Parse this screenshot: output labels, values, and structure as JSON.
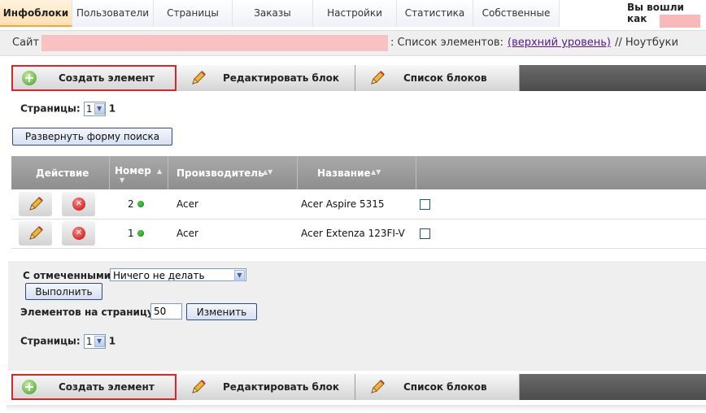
{
  "tabs": [
    {
      "label": "Инфоблоки",
      "active": true
    },
    {
      "label": "Пользователи"
    },
    {
      "label": "Страницы"
    },
    {
      "label": "Заказы"
    },
    {
      "label": "Настройки"
    },
    {
      "label": "Статистика"
    },
    {
      "label": "Собственные"
    }
  ],
  "header": {
    "login_text": "Вы вошли как"
  },
  "breadcrumb": {
    "site_label": "Сайт",
    "list_label": ": Список элементов:",
    "top_level_link": "(верхний уровень)",
    "tail": "// Ноутбуки"
  },
  "toolbar": {
    "create_label": "Создать элемент",
    "edit_block_label": "Редактировать блок",
    "block_list_label": "Список блоков"
  },
  "pager": {
    "label": "Страницы:",
    "current": "1",
    "total": "1"
  },
  "search_toggle_label": "Развернуть форму поиска",
  "table": {
    "headers": {
      "action": "Действие",
      "number": "Номер",
      "manufacturer": "Производитель",
      "name": "Название"
    },
    "rows": [
      {
        "number": "2",
        "manufacturer": "Acer",
        "name": "Acer Aspire 5315"
      },
      {
        "number": "1",
        "manufacturer": "Acer",
        "name": "Acer Extenza 123FI-V"
      }
    ]
  },
  "footer": {
    "with_selected_label": "С отмеченными:",
    "with_selected_value": "Ничего не делать",
    "execute_label": "Выполнить",
    "per_page_label": "Элементов на страницу:",
    "per_page_value": "50",
    "change_label": "Изменить"
  },
  "icons": {
    "create": "plus-circle-icon",
    "edit": "pencil-icon",
    "delete": "delete-icon",
    "status": "status-dot-icon"
  },
  "colors": {
    "active_tab": "#ffe0b0",
    "highlight": "#d9262a",
    "status_ok": "#3cc23c",
    "toolbar_bg": "#4c4c4c"
  }
}
